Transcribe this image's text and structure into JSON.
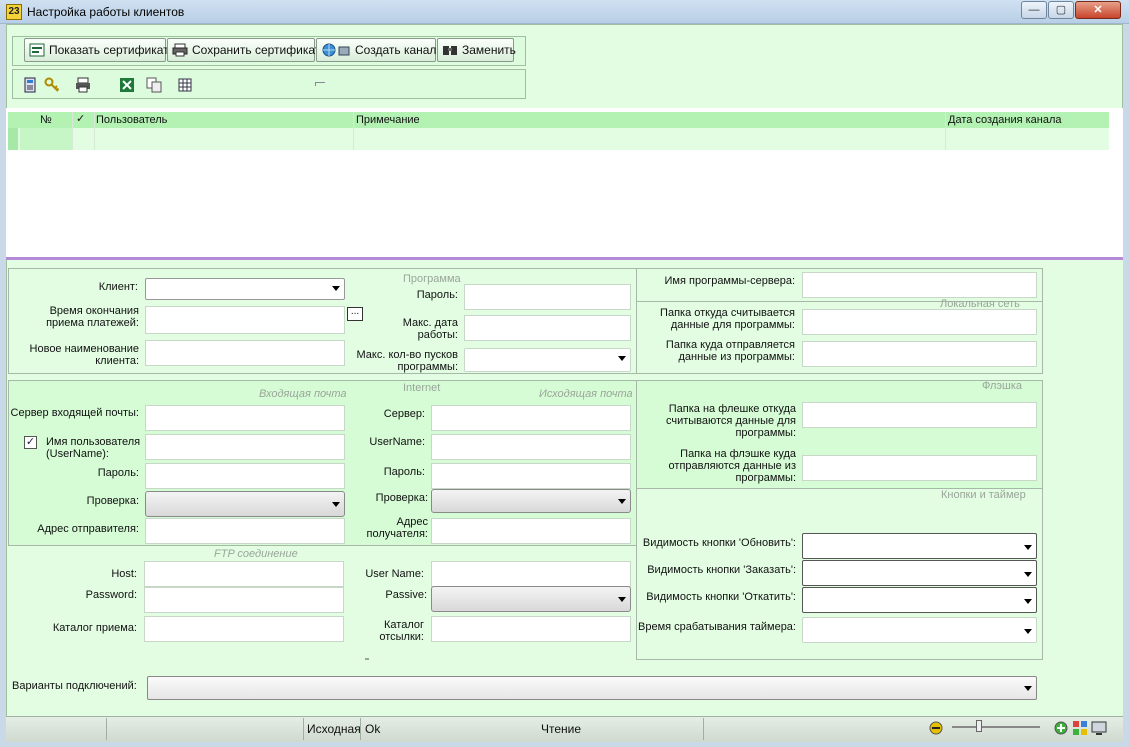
{
  "window": {
    "title": "Настройка работы клиентов",
    "icon_text": "23",
    "controls": {
      "minimize": "—",
      "maximize": "▢",
      "close": "✕"
    }
  },
  "toolbar": {
    "show_cert": "Показать сертификат",
    "save_cert": "Сохранить сертификат",
    "create_channel": "Создать канал",
    "replace": "Заменить",
    "small_icons": [
      "calculator-icon",
      "key-icon",
      "printer-icon",
      "excel-icon",
      "copy-icon",
      "table-icon"
    ]
  },
  "grid": {
    "columns": [
      "№",
      "✓",
      "Пользователь",
      "Примечание",
      "Дата создания канала"
    ]
  },
  "form": {
    "client_label": "Клиент:",
    "payment_end_label": "Время окончания приема платежей:",
    "new_name_label": "Новое наименование клиента:",
    "program_group": "Программа",
    "password_label": "Пароль:",
    "max_date_label": "Макс. дата работы:",
    "max_runs_label": "Макс. кол-во пусков программы:",
    "server_program_label": "Имя программы-сервера:",
    "local_net_group": "Локальная сеть",
    "folder_read_label": "Папка откуда считывается данные для программы:",
    "folder_send_label": "Папка куда отправляется данные из программы:",
    "internet_group": "Internet",
    "incoming_mail_group": "Входящая почта",
    "outgoing_mail_group": "Исходящая почта",
    "incoming_server_label": "Сервер входящей почты:",
    "username_label": "Имя пользователя (UserName):",
    "in_password_label": "Пароль:",
    "in_check_label": "Проверка:",
    "sender_label": "Адрес отправителя:",
    "out_server_label": "Сервер:",
    "out_username_label": "UserName:",
    "out_password_label": "Пароль:",
    "out_check_label": "Проверка:",
    "recipient_label": "Адрес получателя:",
    "flash_group": "Флэшка",
    "flash_read_label": "Папка на флешке откуда считываются данные для программы:",
    "flash_send_label": "Папка на флэшке куда отправляются данные из программы:",
    "buttons_timer_group": "Кнопки  и таймер",
    "vis_refresh_label": "Видимость кнопки 'Обновить':",
    "vis_order_label": "Видимость кнопки 'Заказать':",
    "vis_rollback_label": "Видимость кнопки 'Откатить':",
    "timer_label": "Время срабатывания таймера:",
    "ftp_group": "FTP соединение",
    "host_label": "Host:",
    "ftp_password_label": "Password:",
    "receive_dir_label": "Каталог приема:",
    "ftp_user_label": "User Name:",
    "passive_label": "Passive:",
    "send_dir_label": "Каталог отсылки:",
    "connection_variants_label": "Варианты подключений:"
  },
  "statusbar": {
    "source": "Исходная",
    "ok": "Ok",
    "read": "Чтение"
  }
}
